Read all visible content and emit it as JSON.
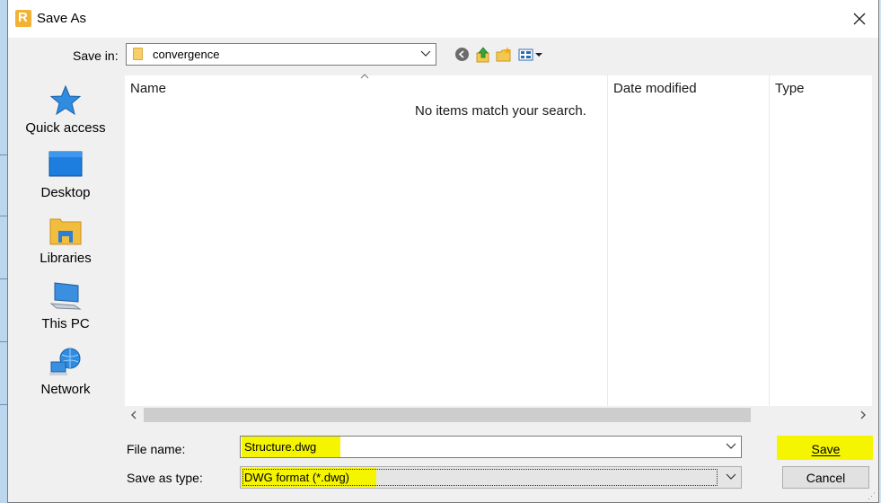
{
  "window": {
    "title": "Save As",
    "app_icon_letter": "R"
  },
  "save_in": {
    "label": "Save in:",
    "value": "convergence"
  },
  "toolbar": {
    "back_icon": "back-arrow-icon",
    "up_icon": "up-folder-icon",
    "new_folder_icon": "new-folder-icon",
    "views_icon": "view-menu-icon"
  },
  "places": [
    {
      "label": "Quick access",
      "icon": "star-icon"
    },
    {
      "label": "Desktop",
      "icon": "desktop-icon"
    },
    {
      "label": "Libraries",
      "icon": "libraries-icon"
    },
    {
      "label": "This PC",
      "icon": "computer-icon"
    },
    {
      "label": "Network",
      "icon": "network-icon"
    }
  ],
  "file_list": {
    "columns": [
      "Name",
      "Date modified",
      "Type"
    ],
    "empty_message": "No items match your search."
  },
  "file_name": {
    "label": "File name:",
    "value": "Structure.dwg"
  },
  "save_as_type": {
    "label": "Save as type:",
    "value": "DWG format (*.dwg)"
  },
  "buttons": {
    "save": "Save",
    "cancel": "Cancel"
  },
  "colors": {
    "highlight": "#f5f500",
    "accent": "#0078d7",
    "folder": "#f6cf6b"
  }
}
